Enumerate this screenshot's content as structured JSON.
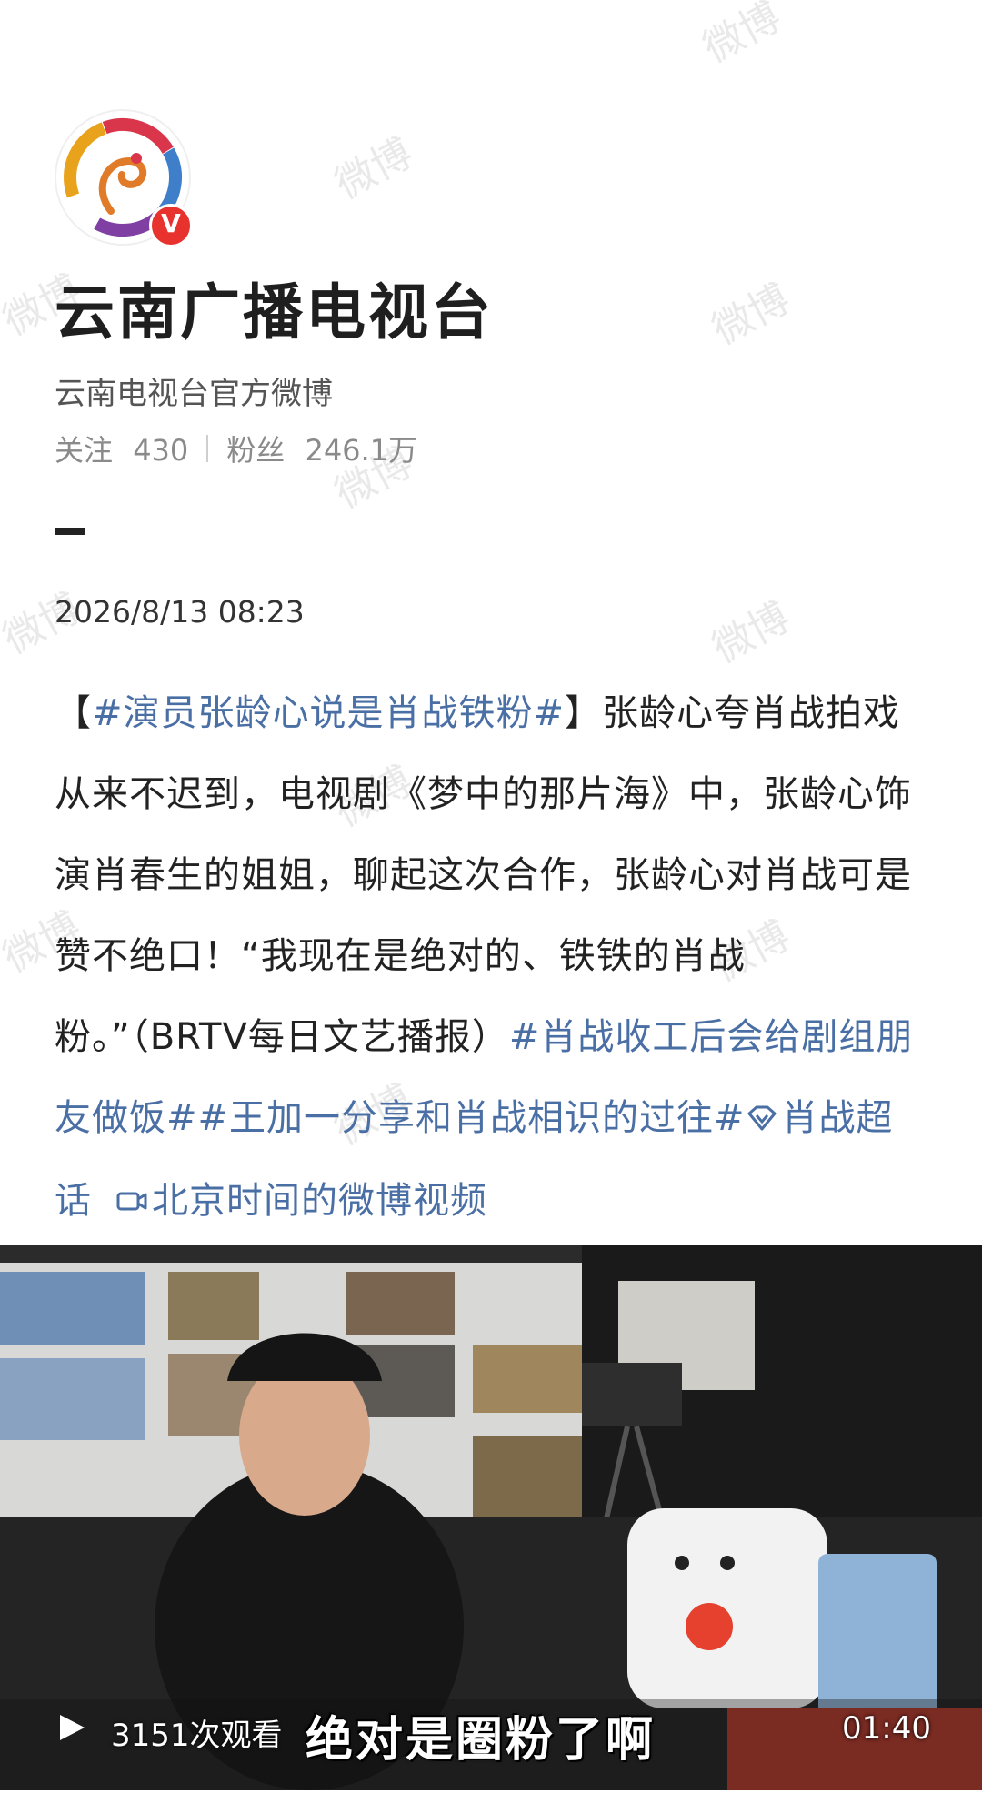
{
  "watermark": "微博",
  "profile": {
    "name": "云南广播电视台",
    "description": "云南电视台官方微博",
    "following_label": "关注",
    "following_count": "430",
    "followers_label": "粉丝",
    "followers_count": "246.1万",
    "verified_badge": "V"
  },
  "post": {
    "date": "2026/8/13 08:23",
    "open_bracket": "【",
    "headline_tag": "#演员张龄心说是肖战铁粉#",
    "close_bracket": "】",
    "body": "张龄心夸肖战拍戏从来不迟到，电视剧《梦中的那片海》中，张龄心饰演肖春生的姐姐，聊起这次合作，张龄心对肖战可是赞不绝口！“我现在是绝对的、铁铁的肖战粉。”（BRTV每日文艺播报）",
    "tag_2": "#肖战收工后会给剧组朋友做饭#",
    "tag_3": "#王加一分享和肖战相识的过往#",
    "supertopic": "肖战超话",
    "video_link": "北京时间的微博视频"
  },
  "video": {
    "caption": "绝对是圈粉了啊",
    "views": "3151次观看",
    "duration": "01:40"
  },
  "colors": {
    "link": "#4a6fa5",
    "verified": "#e8322e"
  }
}
